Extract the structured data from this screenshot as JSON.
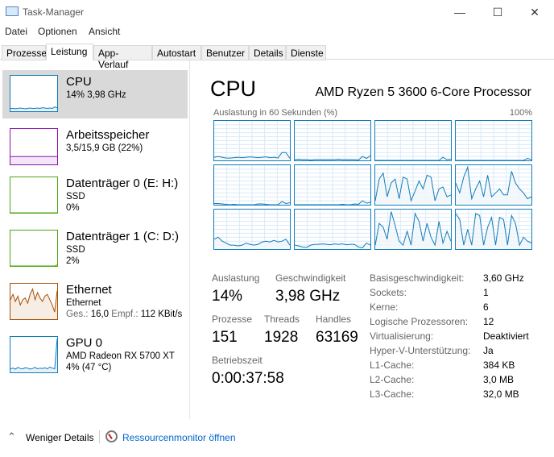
{
  "window": {
    "title": "Task-Manager",
    "minimize": "—",
    "maximize": "☐",
    "close": "✕"
  },
  "menu": [
    "Datei",
    "Optionen",
    "Ansicht"
  ],
  "tabs": [
    "Prozesse",
    "Leistung",
    "App-Verlauf",
    "Autostart",
    "Benutzer",
    "Details",
    "Dienste"
  ],
  "active_tab": "Leistung",
  "sidebar": [
    {
      "name": "CPU",
      "line1": "14% 3,98 GHz",
      "color": "#117dbb",
      "values": [
        8,
        8,
        7,
        8,
        9,
        8,
        7,
        8,
        9,
        8,
        8,
        9,
        8,
        10,
        9,
        8,
        9,
        8,
        12,
        10
      ]
    },
    {
      "name": "Arbeitsspeicher",
      "line1": "3,5/15,9 GB (22%)",
      "color": "#8b12ae",
      "values": [
        22,
        22,
        22,
        22,
        22,
        22,
        22,
        22,
        22,
        22,
        22,
        22,
        22,
        22,
        22,
        22,
        22,
        22,
        22,
        22
      ]
    },
    {
      "name": "Datenträger 0 (E: H:)",
      "line1": "SSD",
      "line2": "0%",
      "color": "#4da60c",
      "values": [
        0,
        0,
        0,
        0,
        0,
        0,
        0,
        0,
        0,
        0,
        0,
        0,
        0,
        0,
        0,
        0,
        0,
        0,
        0,
        0
      ]
    },
    {
      "name": "Datenträger 1 (C: D:)",
      "line1": "SSD",
      "line2": "2%",
      "color": "#4da60c",
      "values": [
        0,
        0,
        0,
        0,
        0,
        0,
        0,
        0,
        0,
        0,
        0,
        0,
        0,
        0,
        0,
        0,
        0,
        0,
        0,
        3
      ]
    },
    {
      "name": "Ethernet",
      "line1": "Ethernet",
      "line2_label1": "Ges.:",
      "line2_val1": "16,0",
      "line2_label2": "Empf.:",
      "line2_val2": "112 KBit/s",
      "color": "#a74f01",
      "values": [
        55,
        70,
        50,
        65,
        40,
        55,
        60,
        45,
        70,
        85,
        55,
        75,
        60,
        50,
        65,
        70,
        55,
        40,
        20,
        80
      ]
    },
    {
      "name": "GPU 0",
      "line1": "AMD Radeon RX 5700 XT",
      "line2": "4% (47 °C)",
      "color": "#117dbb",
      "values": [
        10,
        12,
        9,
        14,
        11,
        10,
        13,
        12,
        9,
        11,
        14,
        10,
        12,
        11,
        13,
        10,
        15,
        12,
        10,
        95
      ]
    }
  ],
  "main": {
    "title": "CPU",
    "model": "AMD Ryzen 5 3600 6-Core Processor",
    "graph_label": "Auslastung in 60 Sekunden (%)",
    "graph_max": "100%",
    "stats": {
      "utilization_label": "Auslastung",
      "utilization": "14%",
      "speed_label": "Geschwindigkeit",
      "speed": "3,98 GHz",
      "processes_label": "Prozesse",
      "processes": "151",
      "threads_label": "Threads",
      "threads": "1928",
      "handles_label": "Handles",
      "handles": "63169",
      "uptime_label": "Betriebszeit",
      "uptime": "0:00:37:58"
    },
    "specs": [
      {
        "k": "Basisgeschwindigkeit:",
        "v": "3,60 GHz"
      },
      {
        "k": "Sockets:",
        "v": "1"
      },
      {
        "k": "Kerne:",
        "v": "6"
      },
      {
        "k": "Logische Prozessoren:",
        "v": "12"
      },
      {
        "k": "Virtualisierung:",
        "v": "Deaktiviert"
      },
      {
        "k": "Hyper-V-Unterstützung:",
        "v": "Ja"
      },
      {
        "k": "L1-Cache:",
        "v": "384 KB"
      },
      {
        "k": "L2-Cache:",
        "v": "3,0 MB"
      },
      {
        "k": "L3-Cache:",
        "v": "32,0 MB"
      }
    ]
  },
  "chart_data": {
    "type": "line",
    "title": "Auslastung in 60 Sekunden (%)",
    "ylim": [
      0,
      100
    ],
    "xlabel": "",
    "ylabel": "%",
    "series": [
      {
        "name": "CPU 0",
        "values": [
          8,
          10,
          8,
          6,
          6,
          7,
          8,
          7,
          8,
          9,
          8,
          7,
          8,
          9,
          7,
          8,
          6,
          20,
          20,
          5
        ]
      },
      {
        "name": "CPU 1",
        "values": [
          2,
          3,
          2,
          2,
          1,
          2,
          2,
          2,
          2,
          2,
          2,
          3,
          2,
          2,
          2,
          2,
          1,
          10,
          5,
          12
        ]
      },
      {
        "name": "CPU 2",
        "values": [
          0,
          0,
          0,
          0,
          0,
          0,
          0,
          0,
          0,
          0,
          0,
          0,
          0,
          0,
          0,
          0,
          0,
          8,
          2,
          3
        ]
      },
      {
        "name": "CPU 3",
        "values": [
          0,
          0,
          0,
          0,
          0,
          0,
          0,
          0,
          0,
          0,
          0,
          0,
          0,
          0,
          0,
          0,
          0,
          0,
          5,
          2
        ]
      },
      {
        "name": "CPU 4",
        "values": [
          3,
          3,
          2,
          1,
          0,
          1,
          0,
          0,
          0,
          0,
          0,
          2,
          2,
          1,
          0,
          0,
          0,
          8,
          3,
          5
        ]
      },
      {
        "name": "CPU 5",
        "values": [
          0,
          0,
          0,
          0,
          0,
          0,
          0,
          0,
          0,
          0,
          0,
          0,
          1,
          0,
          0,
          2,
          1,
          10,
          4,
          6
        ]
      },
      {
        "name": "CPU 6",
        "values": [
          10,
          65,
          80,
          20,
          55,
          65,
          15,
          70,
          65,
          10,
          35,
          60,
          40,
          75,
          70,
          10,
          40,
          45,
          20,
          25
        ]
      },
      {
        "name": "CPU 7",
        "values": [
          55,
          30,
          70,
          95,
          15,
          40,
          60,
          20,
          75,
          20,
          30,
          40,
          25,
          25,
          85,
          55,
          40,
          30,
          15,
          20
        ]
      },
      {
        "name": "CPU 8",
        "values": [
          25,
          30,
          20,
          15,
          10,
          10,
          8,
          10,
          15,
          12,
          10,
          12,
          18,
          20,
          18,
          22,
          18,
          20,
          25,
          10
        ]
      },
      {
        "name": "CPU 9",
        "values": [
          10,
          8,
          5,
          4,
          10,
          12,
          12,
          13,
          12,
          11,
          13,
          12,
          13,
          11,
          12,
          12,
          5,
          3,
          15,
          10
        ]
      },
      {
        "name": "CPU 10",
        "values": [
          10,
          65,
          55,
          25,
          95,
          60,
          20,
          10,
          45,
          10,
          90,
          70,
          20,
          65,
          30,
          10,
          70,
          15,
          45,
          20
        ]
      },
      {
        "name": "CPU 11",
        "values": [
          90,
          75,
          10,
          50,
          10,
          90,
          85,
          10,
          55,
          80,
          10,
          80,
          75,
          10,
          85,
          65,
          10,
          30,
          20,
          15
        ]
      }
    ]
  }
}
